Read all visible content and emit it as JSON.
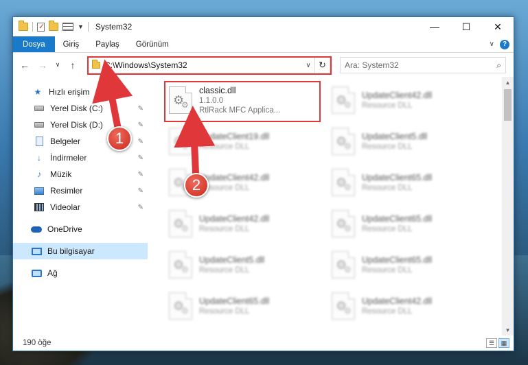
{
  "window": {
    "title": "System32",
    "controls": {
      "minimize": "—",
      "maximize": "☐",
      "close": "✕"
    }
  },
  "ribbon": {
    "tabs": [
      "Dosya",
      "Giriş",
      "Paylaş",
      "Görünüm"
    ],
    "help": "?"
  },
  "nav": {
    "back": "←",
    "forward": "→",
    "recent": "∨",
    "up": "↑",
    "address": "C:\\Windows\\System32",
    "search_placeholder": "Ara: System32"
  },
  "sidebar": {
    "quick_access": "Hızlı erişim",
    "items": [
      {
        "label": "Yerel Disk (C:)",
        "icon": "disk-icon"
      },
      {
        "label": "Yerel Disk (D:)",
        "icon": "disk-icon"
      },
      {
        "label": "Belgeler",
        "icon": "documents-icon"
      },
      {
        "label": "İndirmeler",
        "icon": "downloads-icon"
      },
      {
        "label": "Müzik",
        "icon": "music-icon"
      },
      {
        "label": "Resimler",
        "icon": "pictures-icon"
      },
      {
        "label": "Videolar",
        "icon": "videos-icon"
      }
    ],
    "onedrive": "OneDrive",
    "this_pc": "Bu bilgisayar",
    "network": "Ağ"
  },
  "files": {
    "highlighted": {
      "name": "classic.dll",
      "version": "1.1.0.0",
      "description": "RtlRack MFC Applica..."
    },
    "col1": [
      {
        "name": "UpdateClient19.dll",
        "type": "Resource DLL"
      },
      {
        "name": "UpdateClient42.dll",
        "type": "Resource DLL"
      },
      {
        "name": "UpdateClient42.dll",
        "type": "Resource DLL"
      },
      {
        "name": "UpdateClient5.dll",
        "type": "Resource DLL"
      },
      {
        "name": "UpdateClient65.dll",
        "type": "Resource DLL"
      }
    ],
    "col2": [
      {
        "name": "UpdateClient42.dll",
        "type": "Resource DLL"
      },
      {
        "name": "UpdateClient5.dll",
        "type": "Resource DLL"
      },
      {
        "name": "UpdateClient65.dll",
        "type": "Resource DLL"
      },
      {
        "name": "UpdateClient65.dll",
        "type": "Resource DLL"
      },
      {
        "name": "UpdateClient65.dll",
        "type": "Resource DLL"
      },
      {
        "name": "UpdateClient42.dll",
        "type": "Resource DLL"
      }
    ]
  },
  "status": {
    "count": "190 öğe"
  },
  "annotations": {
    "step1": "1",
    "step2": "2",
    "color": "#e0383a"
  }
}
